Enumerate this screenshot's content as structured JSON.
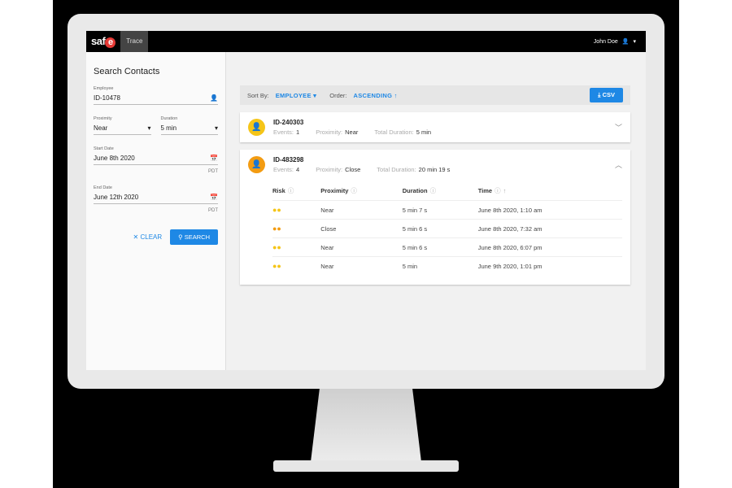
{
  "app": {
    "logo": "safe",
    "tab": "Trace",
    "user": "John Doe"
  },
  "sidebar": {
    "title": "Search Contacts",
    "employee": {
      "label": "Employee",
      "value": "ID-10478"
    },
    "proximity": {
      "label": "Proximity",
      "value": "Near"
    },
    "duration": {
      "label": "Duration",
      "value": "5 min"
    },
    "start": {
      "label": "Start Date",
      "value": "June 8th 2020",
      "tz": "PDT"
    },
    "end": {
      "label": "End Date",
      "value": "June 12th 2020",
      "tz": "PDT"
    },
    "clear": "CLEAR",
    "search": "SEARCH"
  },
  "sortbar": {
    "sort_label": "Sort By:",
    "sort_value": "EMPLOYEE",
    "order_label": "Order:",
    "order_value": "ASCENDING",
    "csv": "CSV"
  },
  "labels": {
    "events": "Events:",
    "proximity": "Proximity:",
    "total": "Total Duration:"
  },
  "contacts": [
    {
      "id": "ID-240303",
      "events": "1",
      "proximity": "Near",
      "total": "5 min",
      "color": "#f5c518",
      "expanded": false
    },
    {
      "id": "ID-483298",
      "events": "4",
      "proximity": "Close",
      "total": "20 min 19 s",
      "color": "#f39c12",
      "expanded": true
    }
  ],
  "table": {
    "headers": [
      "Risk",
      "Proximity",
      "Duration",
      "Time"
    ],
    "rows": [
      {
        "risk": "#f5c518",
        "proximity": "Near",
        "duration": "5 min 7 s",
        "time": "June 8th 2020, 1:10 am"
      },
      {
        "risk": "#f39c12",
        "proximity": "Close",
        "duration": "5 min 6 s",
        "time": "June 8th 2020, 7:32 am"
      },
      {
        "risk": "#f5c518",
        "proximity": "Near",
        "duration": "5 min 6 s",
        "time": "June 8th 2020, 6:07 pm"
      },
      {
        "risk": "#f5c518",
        "proximity": "Near",
        "duration": "5 min",
        "time": "June 9th 2020, 1:01 pm"
      }
    ]
  }
}
